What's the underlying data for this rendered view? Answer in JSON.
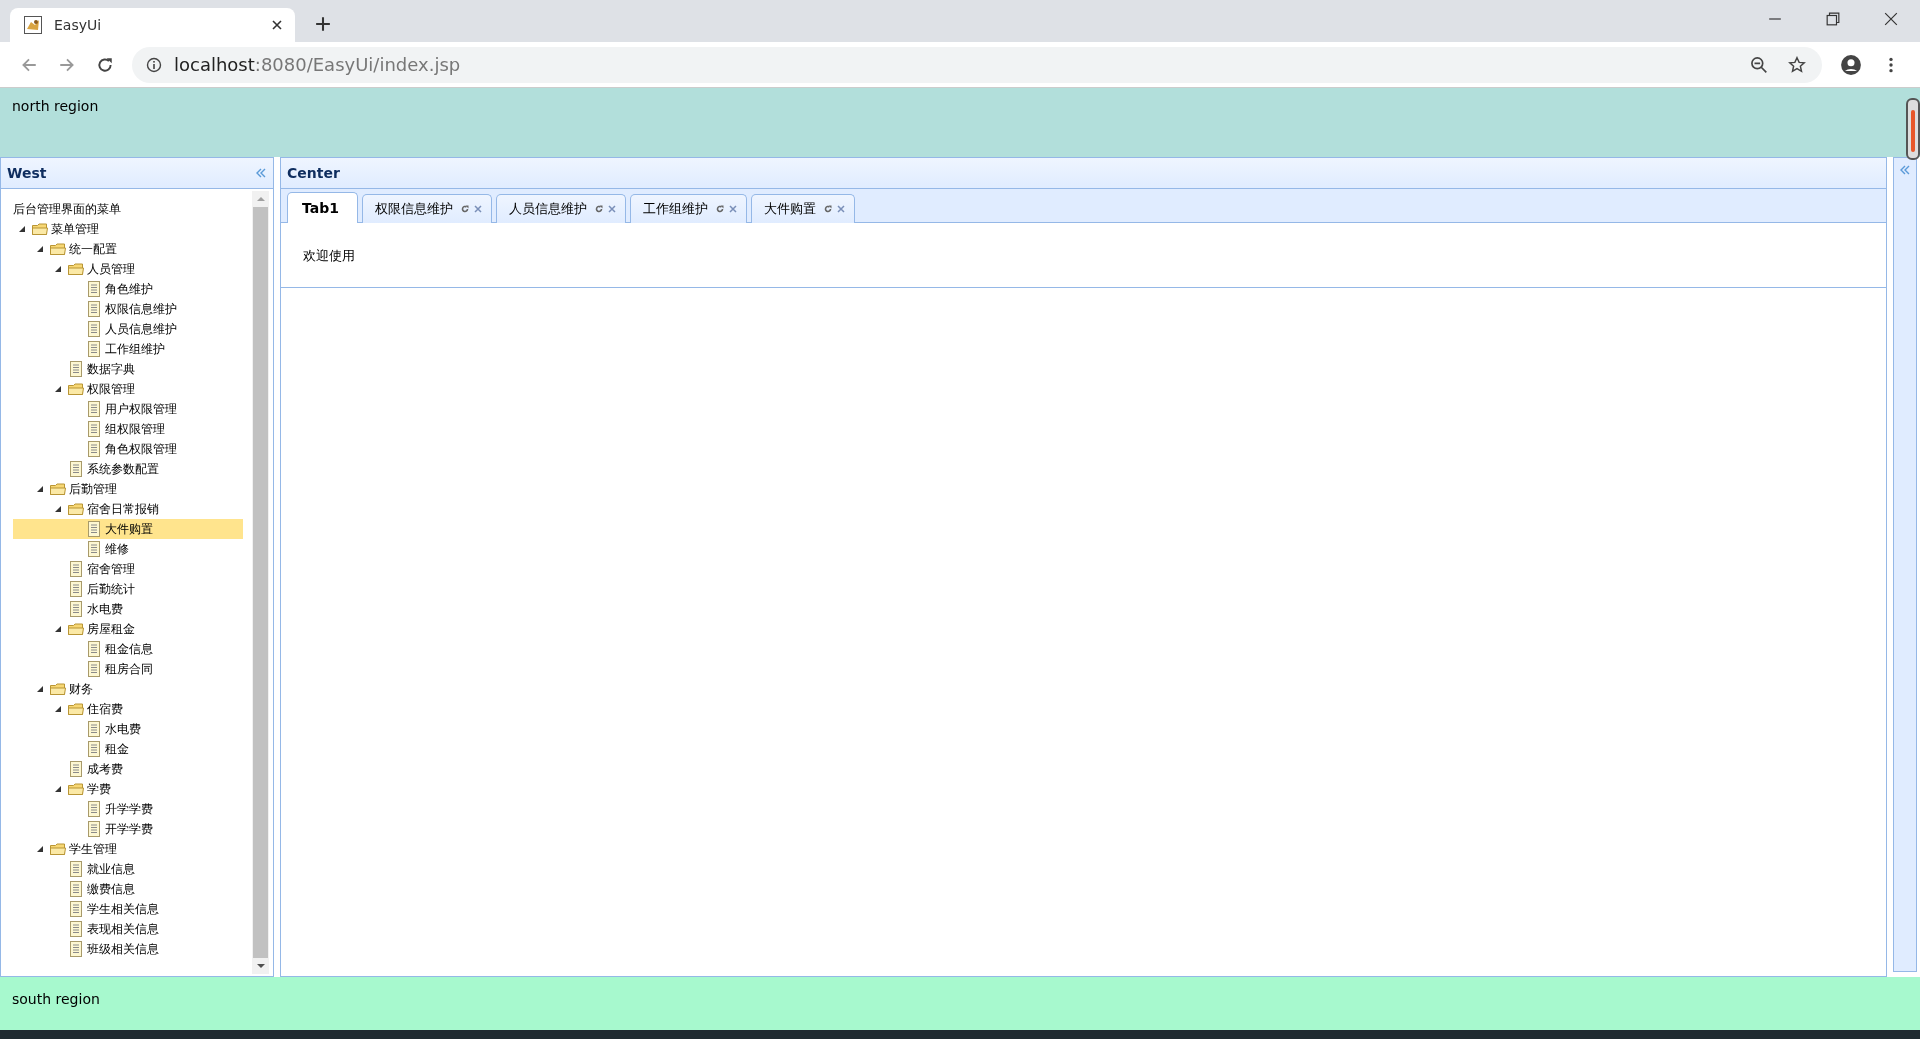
{
  "browser": {
    "tab_title": "EasyUi",
    "url_host": "localhost",
    "url_path": ":8080/EasyUi/index.jsp"
  },
  "north": {
    "text": "north region"
  },
  "west": {
    "title": "West",
    "tree": {
      "root": "后台管理界面的菜单",
      "items": [
        {
          "label": "菜单管理",
          "kind": "folder",
          "expanded": true,
          "selected": false,
          "children": [
            {
              "label": "统一配置",
              "kind": "folder",
              "expanded": true,
              "selected": false,
              "children": [
                {
                  "label": "人员管理",
                  "kind": "folder",
                  "expanded": true,
                  "selected": false,
                  "children": [
                    {
                      "label": "角色维护",
                      "kind": "leaf",
                      "selected": false
                    },
                    {
                      "label": "权限信息维护",
                      "kind": "leaf",
                      "selected": false
                    },
                    {
                      "label": "人员信息维护",
                      "kind": "leaf",
                      "selected": false
                    },
                    {
                      "label": "工作组维护",
                      "kind": "leaf",
                      "selected": false
                    }
                  ]
                },
                {
                  "label": "数据字典",
                  "kind": "leaf",
                  "selected": false
                },
                {
                  "label": "权限管理",
                  "kind": "folder",
                  "expanded": true,
                  "selected": false,
                  "children": [
                    {
                      "label": "用户权限管理",
                      "kind": "leaf",
                      "selected": false
                    },
                    {
                      "label": "组权限管理",
                      "kind": "leaf",
                      "selected": false
                    },
                    {
                      "label": "角色权限管理",
                      "kind": "leaf",
                      "selected": false
                    }
                  ]
                },
                {
                  "label": "系统参数配置",
                  "kind": "leaf",
                  "selected": false
                }
              ]
            },
            {
              "label": "后勤管理",
              "kind": "folder",
              "expanded": true,
              "selected": false,
              "children": [
                {
                  "label": "宿舍日常报销",
                  "kind": "folder",
                  "expanded": true,
                  "selected": false,
                  "children": [
                    {
                      "label": "大件购置",
                      "kind": "leaf",
                      "selected": true
                    },
                    {
                      "label": "维修",
                      "kind": "leaf",
                      "selected": false
                    }
                  ]
                },
                {
                  "label": "宿舍管理",
                  "kind": "leaf",
                  "selected": false
                },
                {
                  "label": "后勤统计",
                  "kind": "leaf",
                  "selected": false
                },
                {
                  "label": "水电费",
                  "kind": "leaf",
                  "selected": false
                },
                {
                  "label": "房屋租金",
                  "kind": "folder",
                  "expanded": true,
                  "selected": false,
                  "children": [
                    {
                      "label": "租金信息",
                      "kind": "leaf",
                      "selected": false
                    },
                    {
                      "label": "租房合同",
                      "kind": "leaf",
                      "selected": false
                    }
                  ]
                }
              ]
            },
            {
              "label": "财务",
              "kind": "folder",
              "expanded": true,
              "selected": false,
              "children": [
                {
                  "label": "住宿费",
                  "kind": "folder",
                  "expanded": true,
                  "selected": false,
                  "children": [
                    {
                      "label": "水电费",
                      "kind": "leaf",
                      "selected": false
                    },
                    {
                      "label": "租金",
                      "kind": "leaf",
                      "selected": false
                    }
                  ]
                },
                {
                  "label": "成考费",
                  "kind": "leaf",
                  "selected": false
                },
                {
                  "label": "学费",
                  "kind": "folder",
                  "expanded": true,
                  "selected": false,
                  "children": [
                    {
                      "label": "升学学费",
                      "kind": "leaf",
                      "selected": false
                    },
                    {
                      "label": "开学学费",
                      "kind": "leaf",
                      "selected": false
                    }
                  ]
                }
              ]
            },
            {
              "label": "学生管理",
              "kind": "folder",
              "expanded": true,
              "selected": false,
              "children": [
                {
                  "label": "就业信息",
                  "kind": "leaf",
                  "selected": false
                },
                {
                  "label": "缴费信息",
                  "kind": "leaf",
                  "selected": false
                },
                {
                  "label": "学生相关信息",
                  "kind": "leaf",
                  "selected": false
                },
                {
                  "label": "表现相关信息",
                  "kind": "leaf",
                  "selected": false
                },
                {
                  "label": "班级相关信息",
                  "kind": "leaf",
                  "selected": false
                }
              ]
            }
          ]
        }
      ]
    }
  },
  "center": {
    "title": "Center",
    "tabs": [
      {
        "label": "Tab1",
        "selected": true,
        "closable": false
      },
      {
        "label": "权限信息维护",
        "selected": false,
        "closable": true
      },
      {
        "label": "人员信息维护",
        "selected": false,
        "closable": true
      },
      {
        "label": "工作组维护",
        "selected": false,
        "closable": true
      },
      {
        "label": "大件购置",
        "selected": false,
        "closable": true
      }
    ],
    "content": "欢迎使用"
  },
  "south": {
    "text": "south region"
  }
}
